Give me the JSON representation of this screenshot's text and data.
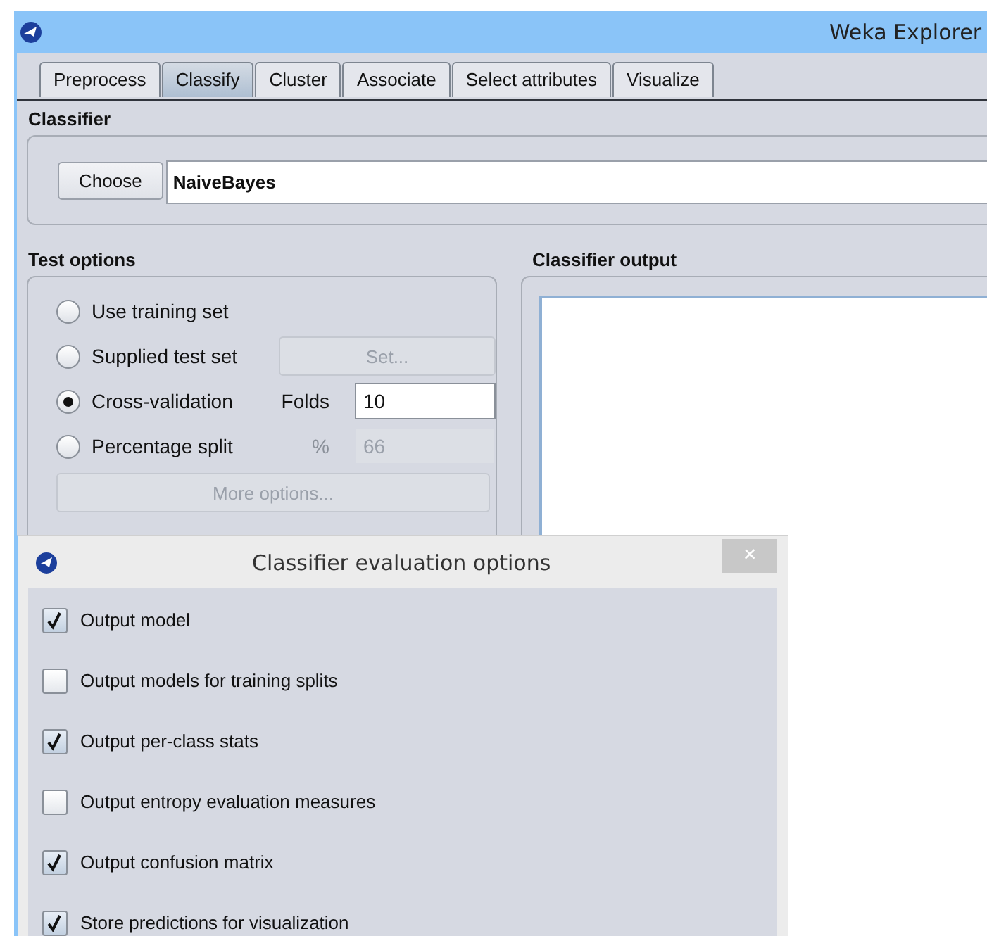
{
  "window": {
    "title": "Weka Explorer"
  },
  "tabs": [
    {
      "label": "Preprocess",
      "selected": false
    },
    {
      "label": "Classify",
      "selected": true
    },
    {
      "label": "Cluster",
      "selected": false
    },
    {
      "label": "Associate",
      "selected": false
    },
    {
      "label": "Select attributes",
      "selected": false
    },
    {
      "label": "Visualize",
      "selected": false
    }
  ],
  "classifier": {
    "label": "Classifier",
    "button": "Choose",
    "value": "NaiveBayes"
  },
  "test_options": {
    "label": "Test options",
    "options": [
      {
        "kind": "plain",
        "label": "Use training set",
        "selected": false
      },
      {
        "kind": "button",
        "label": "Supplied test set",
        "selected": false,
        "button": "Set...",
        "disabled": true
      },
      {
        "kind": "field",
        "label": "Cross-validation",
        "selected": true,
        "field_label": "Folds",
        "value": "10",
        "disabled": false
      },
      {
        "kind": "field",
        "label": "Percentage split",
        "selected": false,
        "field_label": "%",
        "value": "66",
        "disabled": true
      }
    ],
    "more_button": {
      "label": "More options...",
      "disabled": true
    }
  },
  "output": {
    "label": "Classifier output"
  },
  "dialog": {
    "title": "Classifier evaluation options",
    "close": "×",
    "options": [
      {
        "label": "Output model",
        "checked": true
      },
      {
        "label": "Output models for training splits",
        "checked": false
      },
      {
        "label": "Output per-class stats",
        "checked": true
      },
      {
        "label": "Output entropy evaluation measures",
        "checked": false
      },
      {
        "label": "Output confusion matrix",
        "checked": true
      },
      {
        "label": "Store predictions for visualization",
        "checked": true
      }
    ]
  }
}
